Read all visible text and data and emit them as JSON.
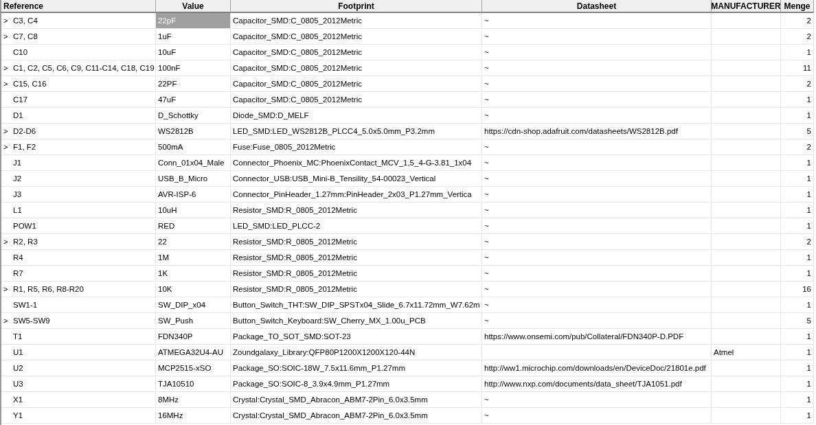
{
  "table": {
    "columns": [
      "Reference",
      "Value",
      "Footprint",
      "Datasheet",
      "MANUFACTURER",
      "Menge"
    ],
    "rows": [
      {
        "expander": ">",
        "reference": "C3, C4",
        "value": "22pF",
        "selected": true,
        "footprint": "Capacitor_SMD:C_0805_2012Metric",
        "datasheet": "~",
        "quantity": "2"
      },
      {
        "expander": ">",
        "reference": "C7, C8",
        "value": "1uF",
        "selected": false,
        "footprint": "Capacitor_SMD:C_0805_2012Metric",
        "datasheet": "~",
        "quantity": "2"
      },
      {
        "reference": "C10",
        "value": "10uF",
        "selected": false,
        "footprint": "Capacitor_SMD:C_0805_2012Metric",
        "datasheet": "~",
        "quantity": "1"
      },
      {
        "expander": ">",
        "reference": "C1, C2, C5, C6, C9, C11-C14, C18, C19",
        "value": "100nF",
        "selected": false,
        "footprint": "Capacitor_SMD:C_0805_2012Metric",
        "datasheet": "~",
        "quantity": "11"
      },
      {
        "expander": ">",
        "reference": "C15, C16",
        "value": "22PF",
        "selected": false,
        "footprint": "Capacitor_SMD:C_0805_2012Metric",
        "datasheet": "~",
        "quantity": "2"
      },
      {
        "reference": "C17",
        "value": "47uF",
        "selected": false,
        "footprint": "Capacitor_SMD:C_0805_2012Metric",
        "datasheet": "~",
        "quantity": "1"
      },
      {
        "reference": "D1",
        "value": "D_Schottky",
        "selected": false,
        "footprint": "Diode_SMD:D_MELF",
        "datasheet": "~",
        "quantity": "1"
      },
      {
        "expander": ">",
        "reference": "D2-D6",
        "value": "WS2812B",
        "selected": false,
        "footprint": "LED_SMD:LED_WS2812B_PLCC4_5.0x5.0mm_P3.2mm",
        "datasheet": "https://cdn-shop.adafruit.com/datasheets/WS2812B.pdf",
        "quantity": "5"
      },
      {
        "expander": ">",
        "reference": "F1, F2",
        "value": "500mA",
        "selected": false,
        "footprint": "Fuse:Fuse_0805_2012Metric",
        "datasheet": "~",
        "quantity": "2"
      },
      {
        "reference": "J1",
        "value": "Conn_01x04_Male",
        "selected": false,
        "footprint": "Connector_Phoenix_MC:PhoenixContact_MCV_1,5_4-G-3.81_1x04",
        "datasheet": "~",
        "quantity": "1"
      },
      {
        "reference": "J2",
        "value": "USB_B_Micro",
        "selected": false,
        "footprint": "Connector_USB:USB_Mini-B_Tensility_54-00023_Vertical",
        "datasheet": "~",
        "quantity": "1"
      },
      {
        "reference": "J3",
        "value": "AVR-ISP-6",
        "selected": false,
        "footprint": "Connector_PinHeader_1.27mm:PinHeader_2x03_P1.27mm_Vertica",
        "datasheet": "~",
        "quantity": "1"
      },
      {
        "reference": "L1",
        "value": "10uH",
        "selected": false,
        "footprint": "Resistor_SMD:R_0805_2012Metric",
        "datasheet": "~",
        "quantity": "1"
      },
      {
        "reference": "POW1",
        "value": "RED",
        "selected": false,
        "footprint": "LED_SMD:LED_PLCC-2",
        "datasheet": "~",
        "quantity": "1"
      },
      {
        "expander": ">",
        "reference": "R2, R3",
        "value": "22",
        "selected": false,
        "footprint": "Resistor_SMD:R_0805_2012Metric",
        "datasheet": "~",
        "quantity": "2"
      },
      {
        "reference": "R4",
        "value": "1M",
        "selected": false,
        "footprint": "Resistor_SMD:R_0805_2012Metric",
        "datasheet": "~",
        "quantity": "1"
      },
      {
        "reference": "R7",
        "value": "1K",
        "selected": false,
        "footprint": "Resistor_SMD:R_0805_2012Metric",
        "datasheet": "~",
        "quantity": "1"
      },
      {
        "expander": ">",
        "reference": "R1, R5, R6, R8-R20",
        "value": "10K",
        "selected": false,
        "footprint": "Resistor_SMD:R_0805_2012Metric",
        "datasheet": "~",
        "quantity": "16"
      },
      {
        "reference": "SW1-1",
        "value": "SW_DIP_x04",
        "selected": false,
        "footprint": "Button_Switch_THT:SW_DIP_SPSTx04_Slide_6.7x11.72mm_W7.62m",
        "datasheet": "~",
        "quantity": "1"
      },
      {
        "expander": ">",
        "reference": "SW5-SW9",
        "value": "SW_Push",
        "selected": false,
        "footprint": "Button_Switch_Keyboard:SW_Cherry_MX_1.00u_PCB",
        "datasheet": "~",
        "quantity": "5"
      },
      {
        "reference": "T1",
        "value": "FDN340P",
        "selected": false,
        "footprint": "Package_TO_SOT_SMD:SOT-23",
        "datasheet": "https://www.onsemi.com/pub/Collateral/FDN340P-D.PDF",
        "quantity": "1"
      },
      {
        "reference": "U1",
        "value": "ATMEGA32U4-AU",
        "selected": false,
        "footprint": "Zoundgalaxy_Library:QFP80P1200X1200X120-44N",
        "manufacturer": "Atmel",
        "quantity": "1"
      },
      {
        "reference": "U2",
        "value": "MCP2515-xSO",
        "selected": false,
        "footprint": "Package_SO:SOIC-18W_7.5x11.6mm_P1.27mm",
        "datasheet": "http://ww1.microchip.com/downloads/en/DeviceDoc/21801e.pdf",
        "quantity": "1"
      },
      {
        "reference": "U3",
        "value": "TJA10510",
        "selected": false,
        "footprint": "Package_SO:SOIC-8_3.9x4.9mm_P1.27mm",
        "datasheet": "http://www.nxp.com/documents/data_sheet/TJA1051.pdf",
        "quantity": "1"
      },
      {
        "reference": "X1",
        "value": "8MHz",
        "selected": false,
        "footprint": "Crystal:Crystal_SMD_Abracon_ABM7-2Pin_6.0x3.5mm",
        "datasheet": "~",
        "quantity": "1"
      },
      {
        "reference": "Y1",
        "value": "16MHz",
        "selected": false,
        "footprint": "Crystal:Crystal_SMD_Abracon_ABM7-2Pin_6.0x3.5mm",
        "datasheet": "~",
        "quantity": "1"
      }
    ]
  }
}
